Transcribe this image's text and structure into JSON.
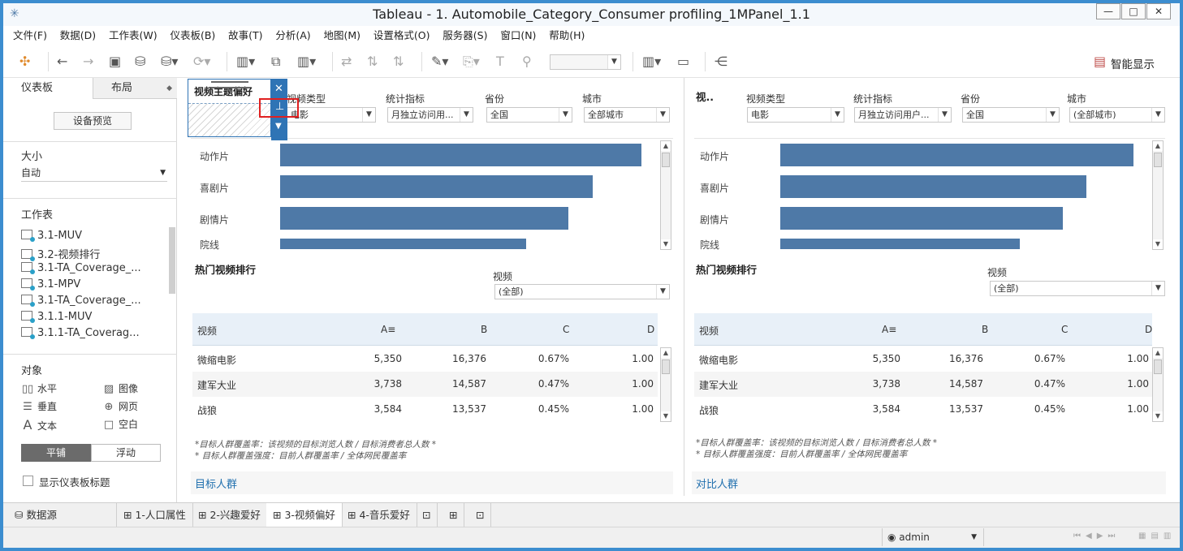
{
  "window": {
    "title": "Tableau - 1. Automobile_Category_Consumer profiling_1MPanel_1.1"
  },
  "menu": [
    "文件(F)",
    "数据(D)",
    "工作表(W)",
    "仪表板(B)",
    "故事(T)",
    "分析(A)",
    "地图(M)",
    "设置格式(O)",
    "服务器(S)",
    "窗口(N)",
    "帮助(H)"
  ],
  "toolbar": {
    "smart_show": "智能显示"
  },
  "left": {
    "tab_dashboard": "仪表板",
    "tab_layout": "布局",
    "device_preview": "设备预览",
    "size_label": "大小",
    "size_value": "自动",
    "sheets_label": "工作表",
    "sheets": [
      "3.1-MUV",
      "3.2-视频排行",
      "3.1-TA_Coverage_...",
      "3.1-MPV",
      "3.1-TA_Coverage_...",
      "3.1.1-MUV",
      "3.1.1-TA_Coverag..."
    ],
    "objects_label": "对象",
    "objects": {
      "horizontal": "水平",
      "image": "图像",
      "vertical": "垂直",
      "web": "网页",
      "text": "文本",
      "blank": "空白"
    },
    "tiled": "平铺",
    "floating": "浮动",
    "show_title": "显示仪表板标题"
  },
  "floating_zone": {
    "title": "视频主题偏好"
  },
  "left_dash": {
    "filters": {
      "video_type_label": "视频类型",
      "video_type_value": "电影",
      "metric_label": "统计指标",
      "metric_value": "月独立访问用...",
      "province_label": "省份",
      "province_value": "全国",
      "city_label": "城市",
      "city_value": "全部城市"
    },
    "categories": [
      "动作片",
      "喜剧片",
      "剧情片",
      "院线"
    ],
    "bar_values": [
      1.0,
      0.866,
      0.798,
      0.682
    ],
    "ranking_title": "热门视频排行",
    "video_filter_label": "视频",
    "video_filter_value": "(全部)",
    "table_headers": [
      "视频",
      "A",
      "B",
      "C",
      "D"
    ],
    "rows": [
      [
        "微缩电影",
        "5,350",
        "16,376",
        "0.67%",
        "1.00"
      ],
      [
        "建军大业",
        "3,738",
        "14,587",
        "0.47%",
        "1.00"
      ],
      [
        "战狼",
        "3,584",
        "13,537",
        "0.45%",
        "1.00"
      ]
    ],
    "note1": "*目标人群覆盖率：该视频的目标浏览人数 / 目标消费者总人数 *",
    "note2": "* 目标人群覆盖强度：目前人群覆盖率 / 全体网民覆盖率",
    "group_label": "目标人群"
  },
  "right_dash": {
    "title": "视..",
    "filters": {
      "video_type_label": "视频类型",
      "video_type_value": "电影",
      "metric_label": "统计指标",
      "metric_value": "月独立访问用户...",
      "province_label": "省份",
      "province_value": "全国",
      "city_label": "城市",
      "city_value": "(全部城市)"
    },
    "categories": [
      "动作片",
      "喜剧片",
      "剧情片",
      "院线"
    ],
    "bar_values": [
      1.0,
      0.867,
      0.8,
      0.678
    ],
    "ranking_title": "热门视频排行",
    "video_filter_label": "视频",
    "video_filter_value": "(全部)",
    "table_headers": [
      "视频",
      "A",
      "B",
      "C",
      "D"
    ],
    "rows": [
      [
        "微缩电影",
        "5,350",
        "16,376",
        "0.67%",
        "1.00"
      ],
      [
        "建军大业",
        "3,738",
        "14,587",
        "0.47%",
        "1.00"
      ],
      [
        "战狼",
        "3,584",
        "13,537",
        "0.45%",
        "1.00"
      ]
    ],
    "note1": "*目标人群覆盖率：该视频的目标浏览人数 / 目标消费者总人数 *",
    "note2": "* 目标人群覆盖强度：目前人群覆盖率 / 全体网民覆盖率",
    "group_label": "对比人群"
  },
  "tabs": {
    "datasource": "数据源",
    "t1": "1-人口属性",
    "t2": "2-兴趣爱好",
    "t3": "3-视频偏好",
    "t4": "4-音乐爱好"
  },
  "status": {
    "user": "admin"
  }
}
